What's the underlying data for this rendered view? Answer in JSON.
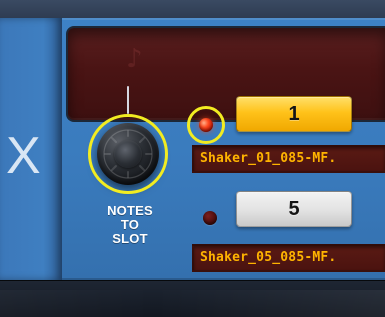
{
  "module": {
    "left_panel_symbol": "X",
    "display_glyph": "♪"
  },
  "knob": {
    "label": "NOTES\nTO\nSLOT",
    "highlighted": true
  },
  "slots": [
    {
      "slot_number": "1",
      "selected": true,
      "led": "on",
      "sample_name": "Shaker_01_085-MF.",
      "highlighted": true
    },
    {
      "slot_number": "5",
      "selected": false,
      "led": "off",
      "sample_name": "Shaker_05_085-MF.",
      "highlighted": false
    }
  ],
  "colors": {
    "panel_blue": "#3d82c6",
    "slot_active": "#ffc21a",
    "slot_inactive": "#e2e2e2",
    "sample_text": "#ffb400",
    "highlight_ring": "#f2ec21",
    "led_on": "#ff4a20",
    "led_off": "#5a1212"
  }
}
